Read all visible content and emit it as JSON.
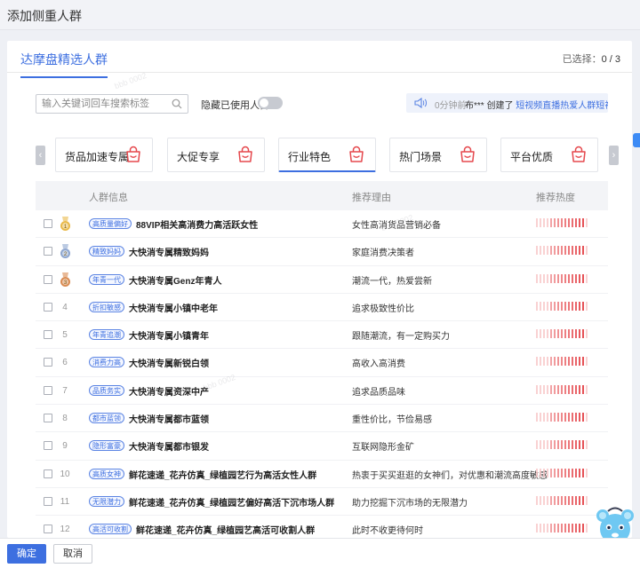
{
  "window": {
    "title": "添加侧重人群",
    "close_icon": "✕"
  },
  "tabs": {
    "active_label": "达摩盘精选人群"
  },
  "selected": {
    "label": "已选择：",
    "count": "0 / 3"
  },
  "search": {
    "placeholder": "输入关键词回车搜索标签",
    "value": "",
    "icon": "search-icon"
  },
  "filter": {
    "hide_used_label": "隐藏已使用人群",
    "hide_used_on": false
  },
  "notice": {
    "time": "0分钟前",
    "user": "布***",
    "action": " 创建了 ",
    "link": "短视频直播热爱人群短视..."
  },
  "categories": [
    {
      "label": "货品加速专属",
      "active": false
    },
    {
      "label": "大促专享",
      "active": false
    },
    {
      "label": "行业特色",
      "active": true
    },
    {
      "label": "热门场景",
      "active": false
    },
    {
      "label": "平台优质",
      "active": false
    }
  ],
  "table": {
    "headers": {
      "info": "人群信息",
      "reason": "推荐理由",
      "heat": "推荐热度"
    },
    "rows": [
      {
        "rank": "1",
        "medal": "gold",
        "tag": "高质量偏好",
        "name": "88VIP相关高消费力高活跃女性",
        "reason": "女性高消货品营销必备",
        "heat": 10
      },
      {
        "rank": "2",
        "medal": "silver",
        "tag": "精致妈妈",
        "name": "大快消专属精致妈妈",
        "reason": "家庭消费决策者",
        "heat": 10
      },
      {
        "rank": "3",
        "medal": "bronze",
        "tag": "年青一代",
        "name": "大快消专属Genz年青人",
        "reason": "潮流一代，热爱尝新",
        "heat": 10
      },
      {
        "rank": "4",
        "medal": "",
        "tag": "折扣敏感",
        "name": "大快消专属小镇中老年",
        "reason": "追求极致性价比",
        "heat": 10
      },
      {
        "rank": "5",
        "medal": "",
        "tag": "年青追潮",
        "name": "大快消专属小镇青年",
        "reason": "跟随潮流，有一定购买力",
        "heat": 10
      },
      {
        "rank": "6",
        "medal": "",
        "tag": "消费力高",
        "name": "大快消专属新锐白领",
        "reason": "高收入高消费",
        "heat": 10
      },
      {
        "rank": "7",
        "medal": "",
        "tag": "品质务实",
        "name": "大快消专属资深中产",
        "reason": "追求品质品味",
        "heat": 10
      },
      {
        "rank": "8",
        "medal": "",
        "tag": "都市蓝领",
        "name": "大快消专属都市蓝领",
        "reason": "重性价比，节俭易感",
        "heat": 10
      },
      {
        "rank": "9",
        "medal": "",
        "tag": "隐形富豪",
        "name": "大快消专属都市银发",
        "reason": "互联网隐形金矿",
        "heat": 10
      },
      {
        "rank": "10",
        "medal": "",
        "tag": "高质女神",
        "name": "鲜花速递_花卉仿真_绿植园艺行为高活女性人群",
        "reason": "热衷于买买逛逛的女神们，对优惠和潮流高度敏感",
        "heat": 10
      },
      {
        "rank": "11",
        "medal": "",
        "tag": "无限潜力",
        "name": "鲜花速递_花卉仿真_绿植园艺偏好高活下沉市场人群",
        "reason": "助力挖掘下沉市场的无限潜力",
        "heat": 10
      },
      {
        "rank": "12",
        "medal": "",
        "tag": "高活可收割",
        "name": "鲜花速递_花卉仿真_绿植园艺高活可收割人群",
        "reason": "此时不收更待何时",
        "heat": 10
      }
    ]
  },
  "footer": {
    "ok_label": "确定",
    "cancel_label": "取消"
  },
  "colors": {
    "accent": "#3d6fe0",
    "heat_strong": "#e5484d",
    "heat_light": "#f7c5c7",
    "gold": "#e9b949",
    "silver": "#8ea6cf",
    "bronze": "#d98b52"
  }
}
